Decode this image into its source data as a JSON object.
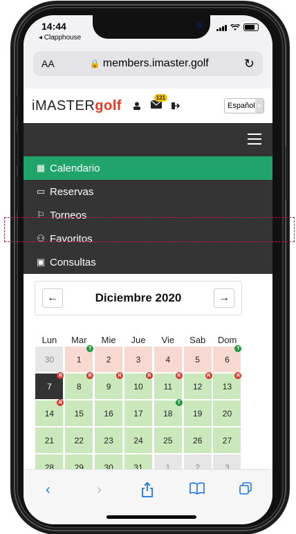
{
  "status": {
    "time": "14:44",
    "back_app": "◂ Clapphouse"
  },
  "browser": {
    "aa_label": "AA",
    "url": "members.imaster.golf"
  },
  "header": {
    "logo_prefix": "iMASTER",
    "logo_golf": "golf",
    "badge_count": "131",
    "language": "Español"
  },
  "menu": {
    "items": [
      {
        "label": "Calendario",
        "icon": "calendar-icon",
        "active": true
      },
      {
        "label": "Reservas",
        "icon": "card-icon"
      },
      {
        "label": "Torneos",
        "icon": "flag-icon"
      },
      {
        "label": "Favoritos",
        "icon": "users-icon"
      },
      {
        "label": "Consultas",
        "icon": "money-icon"
      }
    ]
  },
  "calendar": {
    "month": "Diciembre 2020",
    "weekdays": [
      "Lun",
      "Mar",
      "Mie",
      "Jue",
      "Vie",
      "Sab",
      "Dom"
    ],
    "weeks": [
      [
        {
          "d": "30",
          "c": "gray"
        },
        {
          "d": "1",
          "c": "pink",
          "t": "g"
        },
        {
          "d": "2",
          "c": "pink"
        },
        {
          "d": "3",
          "c": "pink"
        },
        {
          "d": "4",
          "c": "pink"
        },
        {
          "d": "5",
          "c": "pink"
        },
        {
          "d": "6",
          "c": "pink",
          "t": "g"
        }
      ],
      [
        {
          "d": "7",
          "c": "dark",
          "t": "r"
        },
        {
          "d": "8",
          "c": "green",
          "t": "r"
        },
        {
          "d": "9",
          "c": "green",
          "t": "r"
        },
        {
          "d": "10",
          "c": "green",
          "t": "r"
        },
        {
          "d": "11",
          "c": "green",
          "t": "r"
        },
        {
          "d": "12",
          "c": "green",
          "t": "r"
        },
        {
          "d": "13",
          "c": "green",
          "t": "r"
        }
      ],
      [
        {
          "d": "14",
          "c": "green",
          "t": "r"
        },
        {
          "d": "15",
          "c": "green"
        },
        {
          "d": "16",
          "c": "green"
        },
        {
          "d": "17",
          "c": "green"
        },
        {
          "d": "18",
          "c": "green",
          "t": "g"
        },
        {
          "d": "19",
          "c": "green"
        },
        {
          "d": "20",
          "c": "green"
        }
      ],
      [
        {
          "d": "21",
          "c": "green"
        },
        {
          "d": "22",
          "c": "green"
        },
        {
          "d": "23",
          "c": "green"
        },
        {
          "d": "24",
          "c": "green"
        },
        {
          "d": "25",
          "c": "green"
        },
        {
          "d": "26",
          "c": "green"
        },
        {
          "d": "27",
          "c": "green"
        }
      ],
      [
        {
          "d": "28",
          "c": "green"
        },
        {
          "d": "29",
          "c": "green"
        },
        {
          "d": "30",
          "c": "green"
        },
        {
          "d": "31",
          "c": "green"
        },
        {
          "d": "1",
          "c": "gray"
        },
        {
          "d": "2",
          "c": "gray"
        },
        {
          "d": "3",
          "c": "gray"
        }
      ]
    ],
    "tag_r": "R",
    "tag_g": "T"
  },
  "colors": {
    "accent_green": "#20a46a",
    "brand_red": "#e8371e"
  }
}
